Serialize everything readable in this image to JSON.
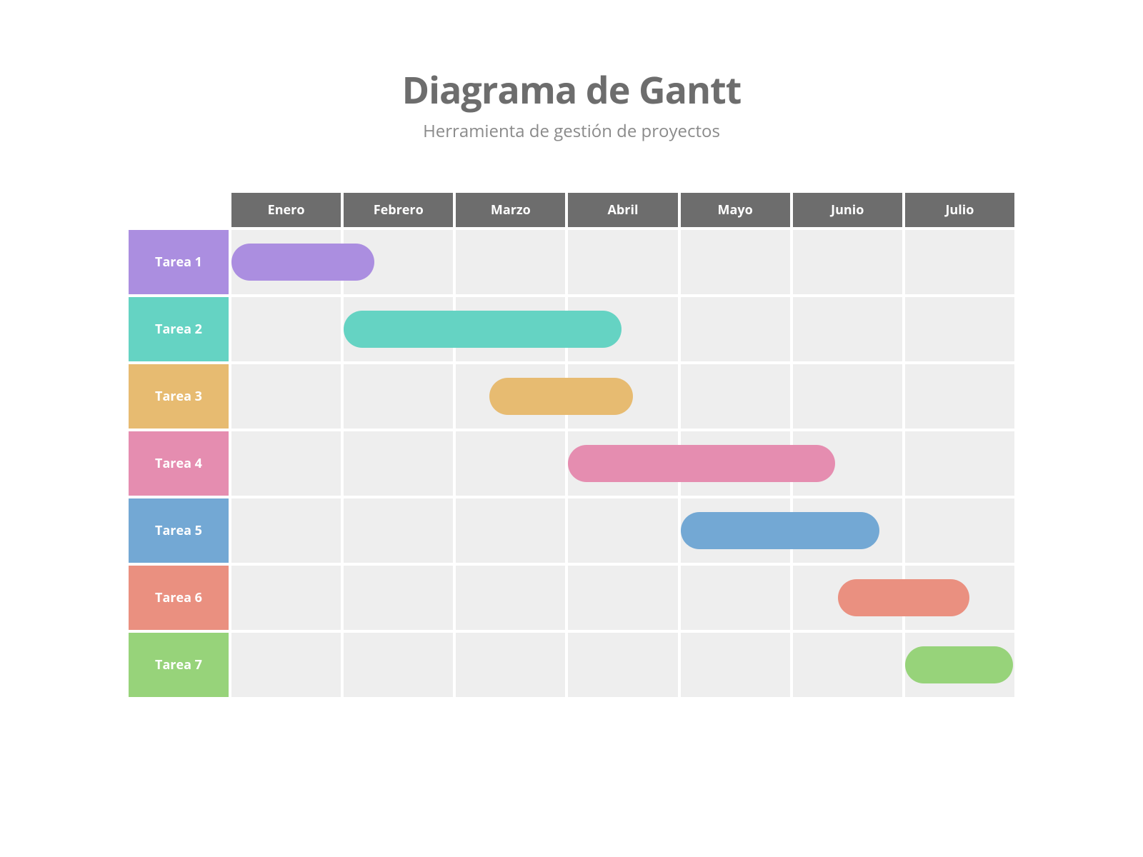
{
  "title": "Diagrama de Gantt",
  "subtitle": "Herramienta de gestión de proyectos",
  "chart_data": {
    "type": "bar",
    "title": "Diagrama de Gantt",
    "categories": [
      "Enero",
      "Febrero",
      "Marzo",
      "Abril",
      "Mayo",
      "Junio",
      "Julio"
    ],
    "xlabel": "",
    "ylabel": "",
    "series": [
      {
        "name": "Tarea 1",
        "start": 0.0,
        "end": 1.3,
        "color": "#ab8ee0"
      },
      {
        "name": "Tarea 2",
        "start": 1.0,
        "end": 3.5,
        "color": "#65d3c3"
      },
      {
        "name": "Tarea 3",
        "start": 2.3,
        "end": 3.6,
        "color": "#e7bb71"
      },
      {
        "name": "Tarea 4",
        "start": 3.0,
        "end": 5.4,
        "color": "#e58db0"
      },
      {
        "name": "Tarea 5",
        "start": 4.0,
        "end": 5.8,
        "color": "#73a8d4"
      },
      {
        "name": "Tarea 6",
        "start": 5.4,
        "end": 6.6,
        "color": "#ea9080"
      },
      {
        "name": "Tarea 7",
        "start": 6.0,
        "end": 7.2,
        "color": "#97d37a"
      }
    ]
  }
}
